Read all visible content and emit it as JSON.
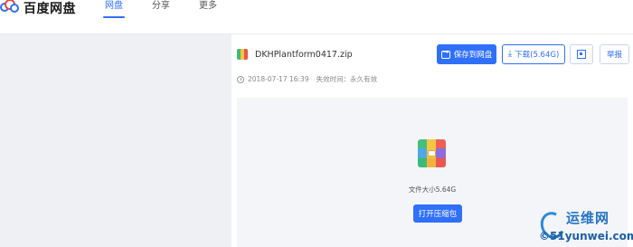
{
  "header": {
    "logo_text": "百度网盘",
    "nav": [
      {
        "label": "网盘",
        "active": true
      },
      {
        "label": "分享",
        "active": false
      },
      {
        "label": "更多",
        "active": false
      }
    ]
  },
  "file": {
    "name": "DKHPlantform0417.zip",
    "date": "2018-07-17 16:39",
    "expiry": "失效时间：永久有效",
    "size_text": "文件大小5.64G"
  },
  "actions": {
    "save_label": "保存到网盘",
    "download_label": "下载(5.64G)",
    "report_label": "举报",
    "open_label": "打开压缩包"
  },
  "watermark": {
    "top_text": "运维网",
    "bottom_text": "©51yunwei.com"
  },
  "colors": {
    "accent": "#2f6ffb",
    "page_bg": "#eef0f4",
    "preview_bg": "#f3f5f9"
  }
}
